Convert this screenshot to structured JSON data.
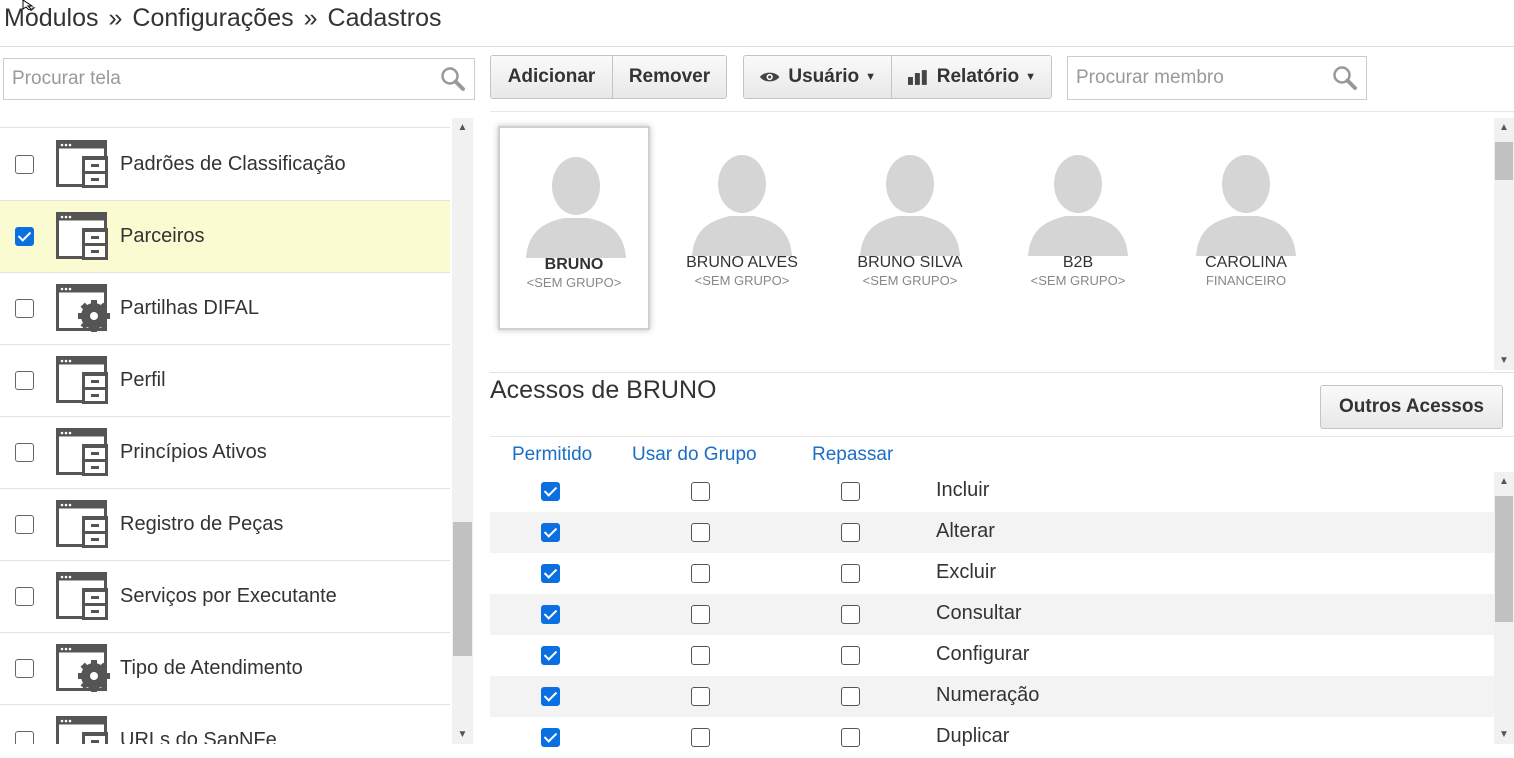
{
  "breadcrumb": {
    "items": [
      "Módulos",
      "Configurações",
      "Cadastros"
    ],
    "separator": "»"
  },
  "left_panel": {
    "search": {
      "placeholder": "Procurar tela"
    },
    "items": [
      {
        "label": "Padrões de Classificação",
        "checked": false,
        "selected": false,
        "icon": "window-cabinet-icon"
      },
      {
        "label": "Parceiros",
        "checked": true,
        "selected": true,
        "icon": "window-cabinet-icon"
      },
      {
        "label": "Partilhas DIFAL",
        "checked": false,
        "selected": false,
        "icon": "window-gear-icon"
      },
      {
        "label": "Perfil",
        "checked": false,
        "selected": false,
        "icon": "window-cabinet-icon"
      },
      {
        "label": "Princípios Ativos",
        "checked": false,
        "selected": false,
        "icon": "window-cabinet-icon"
      },
      {
        "label": "Registro de Peças",
        "checked": false,
        "selected": false,
        "icon": "window-cabinet-icon"
      },
      {
        "label": "Serviços por Executante",
        "checked": false,
        "selected": false,
        "icon": "window-cabinet-icon"
      },
      {
        "label": "Tipo de Atendimento",
        "checked": false,
        "selected": false,
        "icon": "window-gear-icon"
      },
      {
        "label": "URLs do SapNFe",
        "checked": false,
        "selected": false,
        "icon": "window-cabinet-icon"
      }
    ]
  },
  "toolbar": {
    "add_label": "Adicionar",
    "remove_label": "Remover",
    "user_label": "Usuário",
    "report_label": "Relatório",
    "member_search": {
      "placeholder": "Procurar membro"
    }
  },
  "members": [
    {
      "name": "BRUNO",
      "group": "<SEM GRUPO>",
      "selected": true
    },
    {
      "name": "BRUNO ALVES",
      "group": "<SEM GRUPO>",
      "selected": false
    },
    {
      "name": "BRUNO SILVA",
      "group": "<SEM GRUPO>",
      "selected": false
    },
    {
      "name": "B2B",
      "group": "<SEM GRUPO>",
      "selected": false
    },
    {
      "name": "CAROLINA",
      "group": "FINANCEIRO",
      "selected": false
    }
  ],
  "access": {
    "title": "Acessos de BRUNO",
    "other_button": "Outros Acessos",
    "columns": [
      "Permitido",
      "Usar do Grupo",
      "Repassar"
    ],
    "rows": [
      {
        "label": "Incluir",
        "permitido": true,
        "usar_grupo": false,
        "repassar": false
      },
      {
        "label": "Alterar",
        "permitido": true,
        "usar_grupo": false,
        "repassar": false
      },
      {
        "label": "Excluir",
        "permitido": true,
        "usar_grupo": false,
        "repassar": false
      },
      {
        "label": "Consultar",
        "permitido": true,
        "usar_grupo": false,
        "repassar": false
      },
      {
        "label": "Configurar",
        "permitido": true,
        "usar_grupo": false,
        "repassar": false
      },
      {
        "label": "Numeração",
        "permitido": true,
        "usar_grupo": false,
        "repassar": false
      },
      {
        "label": "Duplicar",
        "permitido": true,
        "usar_grupo": false,
        "repassar": false
      }
    ]
  },
  "colors": {
    "accent": "#1a6fc4",
    "checkbox": "#0a6fe0",
    "selected_row": "#fbfbd2"
  }
}
